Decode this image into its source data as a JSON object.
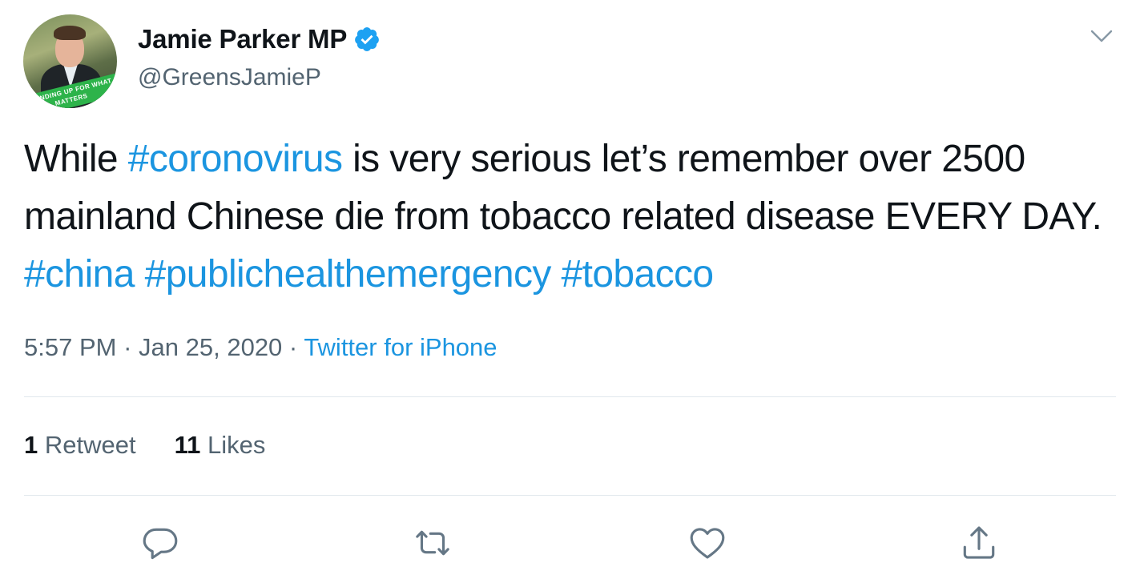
{
  "author": {
    "display_name": "Jamie Parker MP",
    "handle": "@GreensJamieP",
    "verified": true,
    "avatar_banner_text": "STANDING UP FOR WHAT MATTERS"
  },
  "tweet": {
    "segments": [
      {
        "text": "While ",
        "type": "text"
      },
      {
        "text": "#coronovirus",
        "type": "hashtag"
      },
      {
        "text": " is very serious let’s remember over 2500 mainland Chinese die from tobacco related disease EVERY DAY.  ",
        "type": "text"
      },
      {
        "text": "#china",
        "type": "hashtag"
      },
      {
        "text": " ",
        "type": "text"
      },
      {
        "text": "#publichealthemergency",
        "type": "hashtag"
      },
      {
        "text": " ",
        "type": "text"
      },
      {
        "text": "#tobacco",
        "type": "hashtag"
      }
    ],
    "time": "5:57 PM",
    "date": "Jan 25, 2020",
    "separator": "·",
    "source": "Twitter for iPhone"
  },
  "stats": {
    "retweets_count": "1",
    "retweets_label": "Retweet",
    "likes_count": "11",
    "likes_label": "Likes"
  },
  "colors": {
    "accent": "#1b95e0",
    "verified": "#1da1f2",
    "secondary_text": "#536471",
    "divider": "#e1e8ed"
  },
  "icons": {
    "menu": "chevron-down-icon",
    "verified": "verified-badge-icon",
    "reply": "reply-icon",
    "retweet": "retweet-icon",
    "like": "heart-icon",
    "share": "share-icon"
  }
}
